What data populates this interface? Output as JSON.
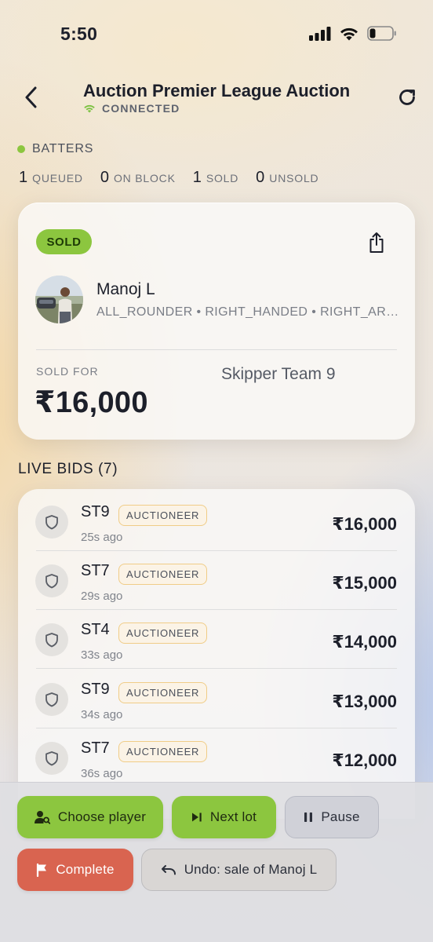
{
  "status_bar": {
    "time": "5:50"
  },
  "header": {
    "title": "Auction Premier League Auction",
    "connection": "CONNECTED"
  },
  "category": {
    "label": "BATTERS",
    "dot_color": "#8cc63f"
  },
  "counts": [
    {
      "num": "1",
      "label": "QUEUED"
    },
    {
      "num": "0",
      "label": "ON BLOCK"
    },
    {
      "num": "1",
      "label": "SOLD"
    },
    {
      "num": "0",
      "label": "UNSOLD"
    }
  ],
  "lot": {
    "status": "SOLD",
    "player_name": "Manoj L",
    "player_meta": "ALL_ROUNDER • RIGHT_HANDED • RIGHT_ARM_MEDIUM",
    "sold_for_label": "SOLD FOR",
    "sold_amount": "₹16,000",
    "team": "Skipper Team 9"
  },
  "bids": {
    "title": "LIVE BIDS (7)",
    "items": [
      {
        "team": "ST9",
        "role": "AUCTIONEER",
        "time": "25s ago",
        "amount": "₹16,000"
      },
      {
        "team": "ST7",
        "role": "AUCTIONEER",
        "time": "29s ago",
        "amount": "₹15,000"
      },
      {
        "team": "ST4",
        "role": "AUCTIONEER",
        "time": "33s ago",
        "amount": "₹14,000"
      },
      {
        "team": "ST9",
        "role": "AUCTIONEER",
        "time": "34s ago",
        "amount": "₹13,000"
      },
      {
        "team": "ST7",
        "role": "AUCTIONEER",
        "time": "36s ago",
        "amount": "₹12,000"
      }
    ]
  },
  "actions": {
    "choose_player": "Choose player",
    "next_lot": "Next lot",
    "pause": "Pause",
    "complete": "Complete",
    "undo": "Undo: sale of Manoj L"
  },
  "colors": {
    "accent_green": "#8cc63f",
    "danger_red": "#d96450",
    "role_border": "#f0cc87"
  }
}
